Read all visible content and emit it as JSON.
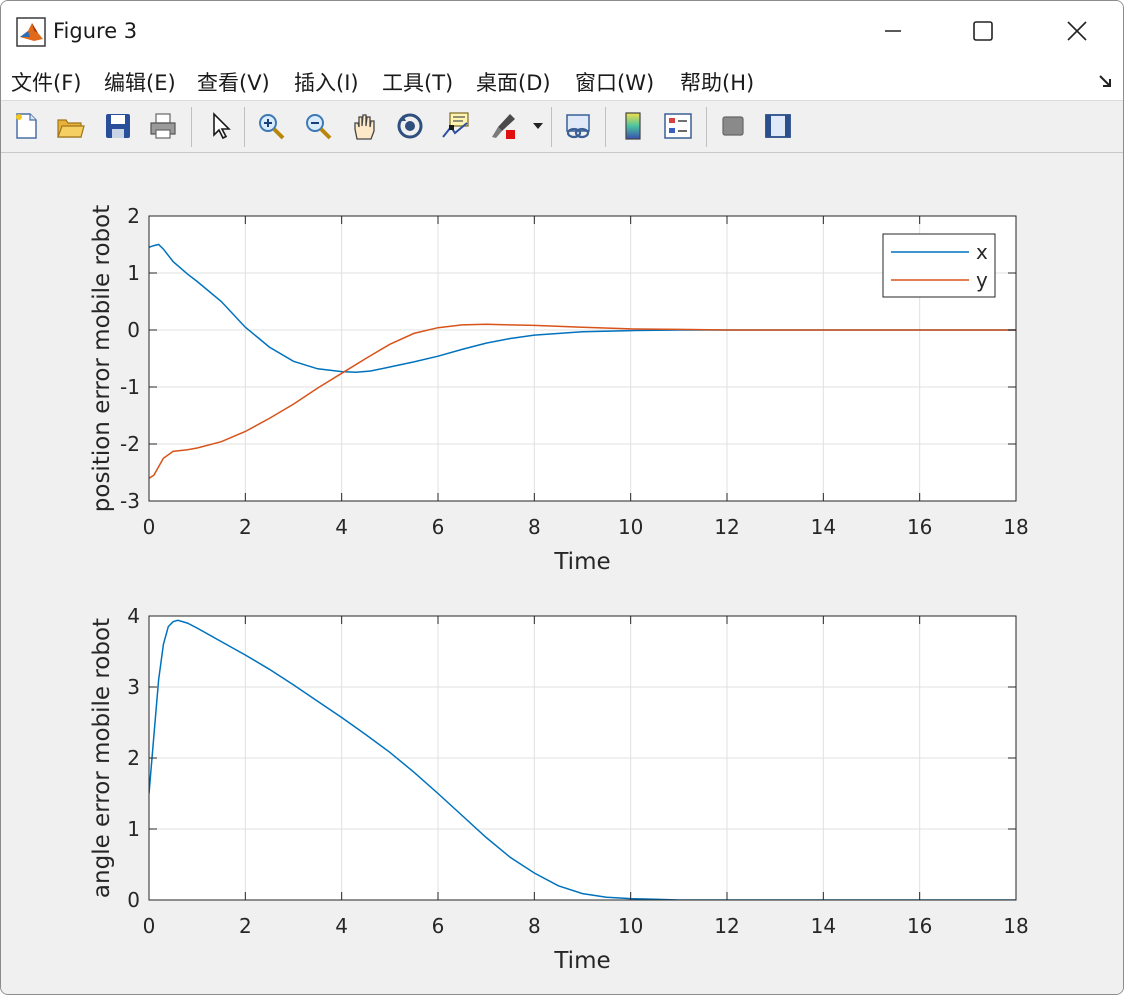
{
  "window": {
    "title": "Figure 3",
    "controls": {
      "minimize": "minimize",
      "maximize": "maximize",
      "close": "close"
    }
  },
  "menubar": {
    "items": [
      {
        "label": "文件(F)"
      },
      {
        "label": "编辑(E)"
      },
      {
        "label": "查看(V)"
      },
      {
        "label": "插入(I)"
      },
      {
        "label": "工具(T)"
      },
      {
        "label": "桌面(D)"
      },
      {
        "label": "窗口(W)"
      },
      {
        "label": "帮助(H)"
      }
    ]
  },
  "toolbar": {
    "buttons": [
      {
        "icon": "new-figure-icon"
      },
      {
        "icon": "open-file-icon"
      },
      {
        "icon": "save-icon"
      },
      {
        "icon": "print-icon"
      },
      {
        "icon": "pointer-icon"
      },
      {
        "icon": "zoom-in-icon"
      },
      {
        "icon": "zoom-out-icon"
      },
      {
        "icon": "pan-hand-icon"
      },
      {
        "icon": "rotate-3d-icon"
      },
      {
        "icon": "data-cursor-icon"
      },
      {
        "icon": "brush-icon"
      },
      {
        "icon": "link-plot-icon"
      },
      {
        "icon": "colorbar-icon"
      },
      {
        "icon": "legend-icon"
      },
      {
        "icon": "hide-plot-tools-icon"
      },
      {
        "icon": "show-plot-tools-icon"
      }
    ]
  },
  "colors": {
    "series_x": "#0072bd",
    "series_y": "#d95319",
    "angle": "#0072bd",
    "grid": "#e0e0e0"
  },
  "chart_data": [
    {
      "type": "line",
      "xlabel": "Time",
      "ylabel": "position error mobile robot",
      "xlim": [
        0,
        18
      ],
      "ylim": [
        -3,
        2
      ],
      "xticks": [
        "0",
        "2",
        "4",
        "6",
        "8",
        "10",
        "12",
        "14",
        "16",
        "18"
      ],
      "yticks": [
        "-3",
        "-2",
        "-1",
        "0",
        "1",
        "2"
      ],
      "grid": true,
      "legend_position": "top-right",
      "series": [
        {
          "name": "x",
          "x": [
            0,
            0.1,
            0.2,
            0.3,
            0.5,
            0.8,
            1.0,
            1.5,
            2.0,
            2.5,
            3.0,
            3.5,
            4.0,
            4.3,
            4.6,
            5.0,
            5.5,
            6.0,
            6.5,
            7.0,
            7.5,
            8.0,
            9.0,
            10.0,
            11.0,
            12.0,
            14.0,
            16.0,
            18.0
          ],
          "y": [
            1.45,
            1.48,
            1.5,
            1.42,
            1.2,
            0.98,
            0.85,
            0.5,
            0.05,
            -0.3,
            -0.55,
            -0.68,
            -0.73,
            -0.74,
            -0.72,
            -0.65,
            -0.56,
            -0.46,
            -0.34,
            -0.23,
            -0.15,
            -0.09,
            -0.03,
            -0.01,
            0.0,
            0.0,
            0.0,
            0.0,
            0.0
          ]
        },
        {
          "name": "y",
          "x": [
            0,
            0.1,
            0.2,
            0.3,
            0.5,
            0.8,
            1.0,
            1.5,
            2.0,
            2.5,
            3.0,
            3.5,
            4.0,
            4.5,
            5.0,
            5.5,
            6.0,
            6.5,
            7.0,
            7.5,
            8.0,
            9.0,
            10.0,
            11.0,
            12.0,
            14.0,
            16.0,
            18.0
          ],
          "y": [
            -2.6,
            -2.55,
            -2.4,
            -2.25,
            -2.13,
            -2.1,
            -2.07,
            -1.96,
            -1.78,
            -1.55,
            -1.3,
            -1.02,
            -0.76,
            -0.5,
            -0.25,
            -0.06,
            0.04,
            0.09,
            0.1,
            0.09,
            0.08,
            0.05,
            0.02,
            0.01,
            0.0,
            0.0,
            0.0,
            0.0
          ]
        }
      ]
    },
    {
      "type": "line",
      "xlabel": "Time",
      "ylabel": "angle error mobile robot",
      "xlim": [
        0,
        18
      ],
      "ylim": [
        0,
        4
      ],
      "xticks": [
        "0",
        "2",
        "4",
        "6",
        "8",
        "10",
        "12",
        "14",
        "16",
        "18"
      ],
      "yticks": [
        "0",
        "1",
        "2",
        "3",
        "4"
      ],
      "grid": true,
      "series": [
        {
          "x": [
            0,
            0.1,
            0.2,
            0.3,
            0.4,
            0.5,
            0.6,
            0.8,
            1.0,
            1.5,
            2.0,
            2.5,
            3.0,
            3.5,
            4.0,
            4.5,
            5.0,
            5.5,
            6.0,
            6.5,
            7.0,
            7.5,
            8.0,
            8.5,
            9.0,
            9.5,
            10.0,
            10.5,
            11.0,
            12.0,
            14.0,
            16.0,
            18.0
          ],
          "y": [
            1.5,
            2.3,
            3.1,
            3.6,
            3.85,
            3.92,
            3.94,
            3.9,
            3.83,
            3.64,
            3.45,
            3.25,
            3.03,
            2.8,
            2.57,
            2.33,
            2.08,
            1.8,
            1.5,
            1.19,
            0.88,
            0.6,
            0.38,
            0.2,
            0.09,
            0.04,
            0.02,
            0.01,
            0.0,
            0.0,
            0.0,
            0.0,
            0.0
          ]
        }
      ]
    }
  ]
}
